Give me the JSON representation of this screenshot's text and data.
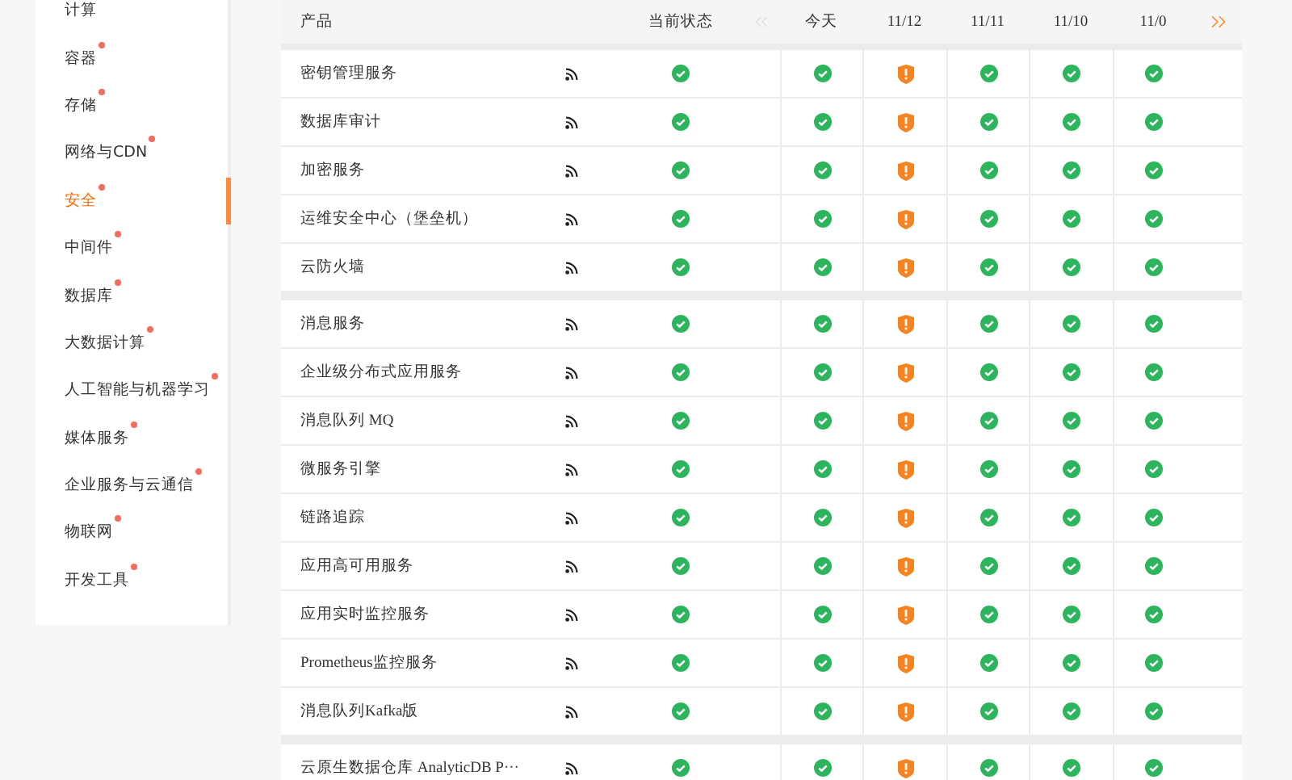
{
  "sidebar": {
    "items": [
      {
        "label": "计算",
        "selected": false
      },
      {
        "label": "容器",
        "selected": false
      },
      {
        "label": "存储",
        "selected": false
      },
      {
        "label": "网络与CDN",
        "selected": false
      },
      {
        "label": "安全",
        "selected": true
      },
      {
        "label": "中间件",
        "selected": false
      },
      {
        "label": "数据库",
        "selected": false
      },
      {
        "label": "大数据计算",
        "selected": false
      },
      {
        "label": "人工智能与机器学习",
        "selected": false
      },
      {
        "label": "媒体服务",
        "selected": false
      },
      {
        "label": "企业服务与云通信",
        "selected": false
      },
      {
        "label": "物联网",
        "selected": false
      },
      {
        "label": "开发工具",
        "selected": false
      }
    ]
  },
  "table": {
    "columns": [
      "产品",
      "当前状态",
      "今天",
      "11/12",
      "11/11",
      "11/10",
      "11/0"
    ],
    "pager": {
      "prev_disabled": true,
      "next_disabled": false
    },
    "groups": [
      {
        "rows": [
          {
            "name": "密钥管理服务",
            "statuses": [
              {
                "kind": "ok"
              },
              {
                "kind": "ok"
              },
              {
                "kind": "warning"
              },
              {
                "kind": "ok"
              },
              {
                "kind": "ok"
              },
              {
                "kind": "ok"
              }
            ]
          },
          {
            "name": "数据库审计",
            "statuses": [
              {
                "kind": "ok"
              },
              {
                "kind": "ok"
              },
              {
                "kind": "warning"
              },
              {
                "kind": "ok"
              },
              {
                "kind": "ok"
              },
              {
                "kind": "ok"
              }
            ]
          },
          {
            "name": "加密服务",
            "statuses": [
              {
                "kind": "ok"
              },
              {
                "kind": "ok"
              },
              {
                "kind": "warning"
              },
              {
                "kind": "ok"
              },
              {
                "kind": "ok"
              },
              {
                "kind": "ok"
              }
            ]
          },
          {
            "name": "运维安全中心（堡垒机）",
            "statuses": [
              {
                "kind": "ok"
              },
              {
                "kind": "ok"
              },
              {
                "kind": "warning"
              },
              {
                "kind": "ok"
              },
              {
                "kind": "ok"
              },
              {
                "kind": "ok"
              }
            ]
          },
          {
            "name": "云防火墙",
            "statuses": [
              {
                "kind": "ok"
              },
              {
                "kind": "ok"
              },
              {
                "kind": "warning"
              },
              {
                "kind": "ok"
              },
              {
                "kind": "ok"
              },
              {
                "kind": "ok"
              }
            ]
          }
        ]
      },
      {
        "rows": [
          {
            "name": "消息服务",
            "statuses": [
              {
                "kind": "ok"
              },
              {
                "kind": "ok"
              },
              {
                "kind": "warning"
              },
              {
                "kind": "ok"
              },
              {
                "kind": "ok"
              },
              {
                "kind": "ok"
              }
            ]
          },
          {
            "name": "企业级分布式应用服务",
            "statuses": [
              {
                "kind": "ok"
              },
              {
                "kind": "ok"
              },
              {
                "kind": "warning"
              },
              {
                "kind": "ok"
              },
              {
                "kind": "ok"
              },
              {
                "kind": "ok"
              }
            ]
          },
          {
            "name": "消息队列 MQ",
            "statuses": [
              {
                "kind": "ok"
              },
              {
                "kind": "ok"
              },
              {
                "kind": "warning"
              },
              {
                "kind": "ok"
              },
              {
                "kind": "ok"
              },
              {
                "kind": "ok"
              }
            ]
          },
          {
            "name": "微服务引擎",
            "statuses": [
              {
                "kind": "ok"
              },
              {
                "kind": "ok"
              },
              {
                "kind": "warning"
              },
              {
                "kind": "ok"
              },
              {
                "kind": "ok"
              },
              {
                "kind": "ok"
              }
            ]
          },
          {
            "name": "链路追踪",
            "statuses": [
              {
                "kind": "ok"
              },
              {
                "kind": "ok"
              },
              {
                "kind": "warning"
              },
              {
                "kind": "ok"
              },
              {
                "kind": "ok"
              },
              {
                "kind": "ok"
              }
            ]
          },
          {
            "name": "应用高可用服务",
            "statuses": [
              {
                "kind": "ok"
              },
              {
                "kind": "ok"
              },
              {
                "kind": "warning"
              },
              {
                "kind": "ok"
              },
              {
                "kind": "ok"
              },
              {
                "kind": "ok"
              }
            ]
          },
          {
            "name": "应用实时监控服务",
            "statuses": [
              {
                "kind": "ok"
              },
              {
                "kind": "ok"
              },
              {
                "kind": "warning"
              },
              {
                "kind": "ok"
              },
              {
                "kind": "ok"
              },
              {
                "kind": "ok"
              }
            ]
          },
          {
            "name": "Prometheus监控服务",
            "statuses": [
              {
                "kind": "ok"
              },
              {
                "kind": "ok"
              },
              {
                "kind": "warning"
              },
              {
                "kind": "ok"
              },
              {
                "kind": "ok"
              },
              {
                "kind": "ok"
              }
            ]
          },
          {
            "name": "消息队列Kafka版",
            "statuses": [
              {
                "kind": "ok"
              },
              {
                "kind": "ok"
              },
              {
                "kind": "warning"
              },
              {
                "kind": "ok"
              },
              {
                "kind": "ok"
              },
              {
                "kind": "ok"
              }
            ]
          }
        ]
      },
      {
        "rows": [
          {
            "name": "云原生数据仓库 AnalyticDB P···",
            "statuses": [
              {
                "kind": "ok"
              },
              {
                "kind": "ok"
              },
              {
                "kind": "warning"
              },
              {
                "kind": "ok"
              },
              {
                "kind": "ok"
              },
              {
                "kind": "ok"
              }
            ]
          }
        ]
      }
    ]
  }
}
